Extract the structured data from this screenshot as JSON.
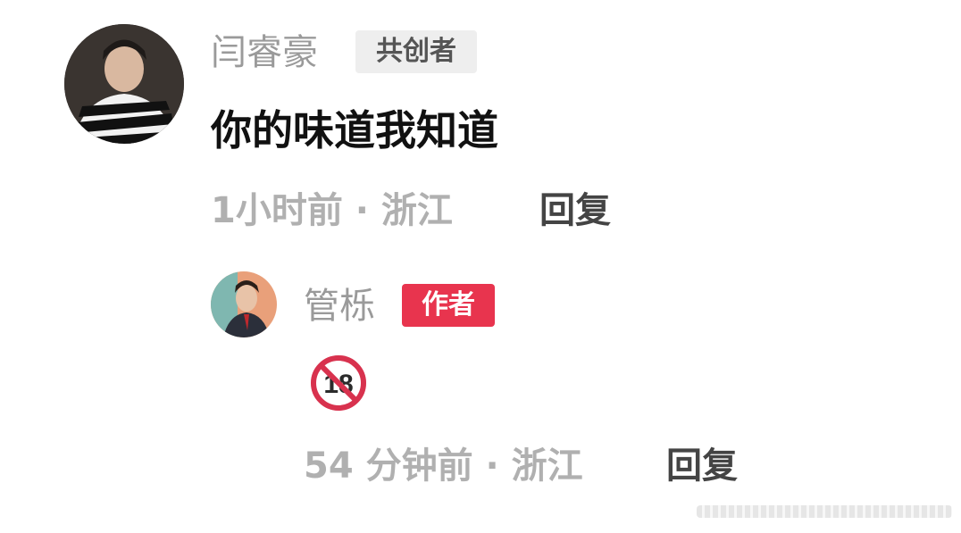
{
  "comment": {
    "author": "闫睿豪",
    "badge": "共创者",
    "text": "你的味道我知道",
    "meta": "1小时前 · 浙江",
    "reply_label": "回复"
  },
  "reply": {
    "author": "管栎",
    "badge": "作者",
    "emoji_label": "18",
    "meta": "54 分钟前 · 浙江",
    "reply_label": "回复"
  },
  "colors": {
    "author_tag": "#e8344e",
    "meta_text": "#b0b0b0",
    "name_text": "#9a9a9a"
  }
}
